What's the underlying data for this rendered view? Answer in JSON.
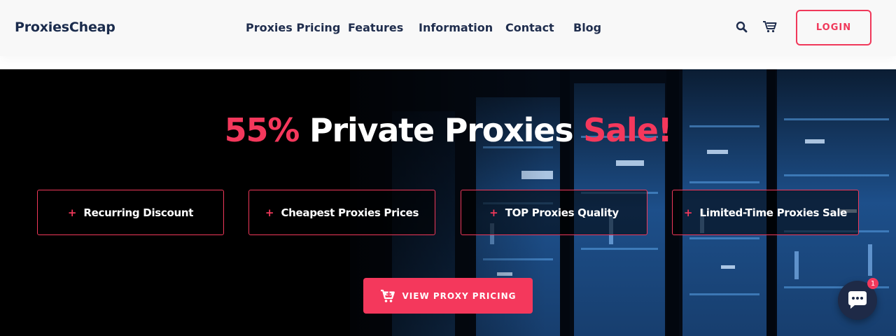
{
  "header": {
    "logo": "ProxiesCheap",
    "nav": [
      {
        "label": "Proxies Pricing"
      },
      {
        "label": "Features"
      },
      {
        "label": "Information"
      },
      {
        "label": "Contact"
      },
      {
        "label": "Blog"
      }
    ],
    "search_icon": "search-icon",
    "cart_icon": "cart-icon",
    "login_label": "LOGIN"
  },
  "hero": {
    "headline": {
      "percent": "55%",
      "middle": "Private Proxies",
      "end": "Sale!"
    },
    "features": [
      {
        "label": "Recurring Discount"
      },
      {
        "label": "Cheapest Proxies Prices"
      },
      {
        "label": "TOP Proxies Quality"
      },
      {
        "label": "Limited-Time Proxies Sale"
      }
    ],
    "cta_label": "VIEW PROXY PRICING",
    "cta_icon": "cart-plus-icon"
  },
  "chat": {
    "icon": "chat-bubble-icon",
    "badge": "1"
  },
  "colors": {
    "accent": "#f4385c",
    "navy": "#1f2d4d",
    "hero_bg": "#000000",
    "server_blue": "#1f5fa8"
  }
}
